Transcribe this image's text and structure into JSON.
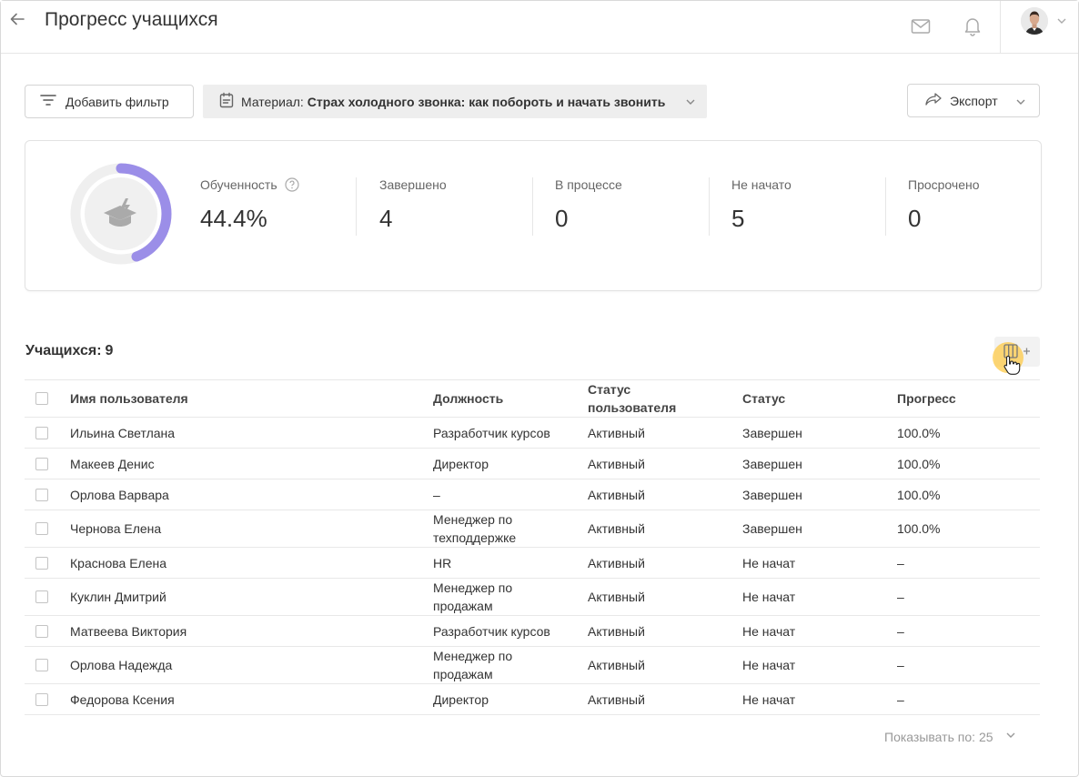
{
  "header": {
    "title": "Прогресс учащихся",
    "icons": [
      "back-arrow-icon",
      "mail-icon",
      "bell-icon",
      "chevron-down-icon"
    ]
  },
  "toolbar": {
    "filter_label": "Добавить фильтр",
    "material_label": "Материал:",
    "material_value": "Страх холодного звонка: как побороть и начать звонить",
    "export_label": "Экспорт"
  },
  "stats": {
    "progress_fraction": 0.444,
    "accent_color": "#9b8ee8",
    "items": [
      {
        "label": "Обученность",
        "value": "44.4%"
      },
      {
        "label": "Завершено",
        "value": "4"
      },
      {
        "label": "В процессе",
        "value": "0"
      },
      {
        "label": "Не начато",
        "value": "5"
      },
      {
        "label": "Просрочено",
        "value": "0"
      }
    ]
  },
  "table": {
    "count_label": "Учащихся:",
    "count": "9",
    "headers": [
      "Имя пользователя",
      "Должность",
      "Статус пользователя",
      "Статус",
      "Прогресс"
    ],
    "rows": [
      {
        "name": "Ильина Светлана",
        "position": "Разработчик курсов",
        "user_status": "Активный",
        "status": "Завершен",
        "progress": "100.0%"
      },
      {
        "name": "Макеев Денис",
        "position": "Директор",
        "user_status": "Активный",
        "status": "Завершен",
        "progress": "100.0%"
      },
      {
        "name": "Орлова Варвара",
        "position": "–",
        "user_status": "Активный",
        "status": "Завершен",
        "progress": "100.0%"
      },
      {
        "name": "Чернова Елена",
        "position": "Менеджер по техподдержке",
        "user_status": "Активный",
        "status": "Завершен",
        "progress": "100.0%"
      },
      {
        "name": "Краснова Елена",
        "position": "HR",
        "user_status": "Активный",
        "status": "Не начат",
        "progress": "–"
      },
      {
        "name": "Куклин Дмитрий",
        "position": "Менеджер по продажам",
        "user_status": "Активный",
        "status": "Не начат",
        "progress": "–"
      },
      {
        "name": "Матвеева Виктория",
        "position": "Разработчик курсов",
        "user_status": "Активный",
        "status": "Не начат",
        "progress": "–"
      },
      {
        "name": "Орлова Надежда",
        "position": "Менеджер по продажам",
        "user_status": "Активный",
        "status": "Не начат",
        "progress": "–"
      },
      {
        "name": "Федорова Ксения",
        "position": "Директор",
        "user_status": "Активный",
        "status": "Не начат",
        "progress": "–"
      }
    ]
  },
  "pager": {
    "label": "Показывать по:",
    "value": "25"
  }
}
